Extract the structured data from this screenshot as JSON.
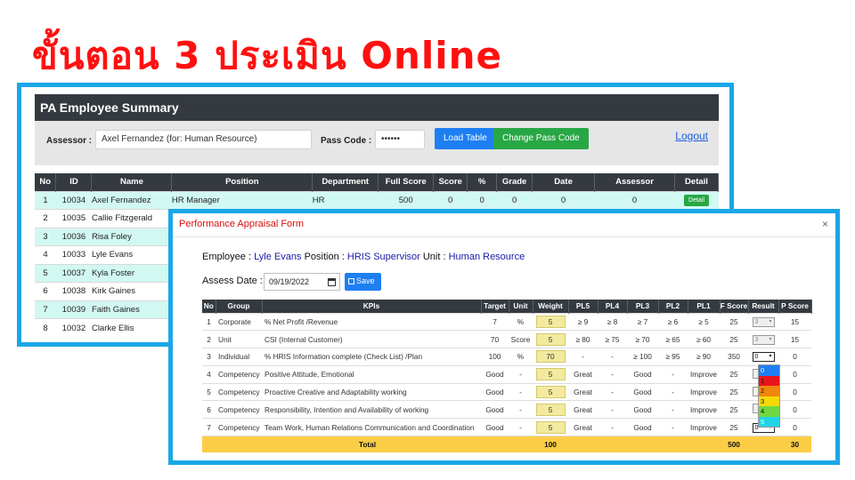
{
  "headline": "ขั้นตอน 3 ประเมิน Online",
  "back": {
    "title": "PA Employee Summary",
    "assessor_label": "Assessor :",
    "assessor_value": "Axel Fernandez (for: Human Resource)",
    "pass_label": "Pass Code :",
    "pass_value": "••••••",
    "load_label": "Load Table",
    "change_label": "Change Pass Code",
    "logout_label": "Logout",
    "columns": [
      "No",
      "ID",
      "Name",
      "Position",
      "Department",
      "Full Score",
      "Score",
      "%",
      "Grade",
      "Date",
      "Assessor",
      "Detail"
    ],
    "rows": [
      {
        "no": "1",
        "id": "10034",
        "name": "Axel Fernandez",
        "position": "HR Manager",
        "dept": "HR",
        "full": "500",
        "score": "0",
        "pct": "0",
        "grade": "0",
        "date": "0",
        "assessor": "0",
        "detail": "Detail"
      },
      {
        "no": "2",
        "id": "10035",
        "name": "Callie Fitzgerald",
        "position": "",
        "dept": "",
        "full": "",
        "score": "",
        "pct": "",
        "grade": "",
        "date": "",
        "assessor": "",
        "detail": ""
      },
      {
        "no": "3",
        "id": "10036",
        "name": "Risa Foley",
        "position": "",
        "dept": "",
        "full": "",
        "score": "",
        "pct": "",
        "grade": "",
        "date": "",
        "assessor": "",
        "detail": ""
      },
      {
        "no": "4",
        "id": "10033",
        "name": "Lyle Evans",
        "position": "",
        "dept": "",
        "full": "",
        "score": "",
        "pct": "",
        "grade": "",
        "date": "",
        "assessor": "",
        "detail": ""
      },
      {
        "no": "5",
        "id": "10037",
        "name": "Kyla Foster",
        "position": "",
        "dept": "",
        "full": "",
        "score": "",
        "pct": "",
        "grade": "",
        "date": "",
        "assessor": "",
        "detail": ""
      },
      {
        "no": "6",
        "id": "10038",
        "name": "Kirk Gaines",
        "position": "",
        "dept": "",
        "full": "",
        "score": "",
        "pct": "",
        "grade": "",
        "date": "",
        "assessor": "",
        "detail": ""
      },
      {
        "no": "7",
        "id": "10039",
        "name": "Faith Gaines",
        "position": "",
        "dept": "",
        "full": "",
        "score": "",
        "pct": "",
        "grade": "",
        "date": "",
        "assessor": "",
        "detail": ""
      },
      {
        "no": "8",
        "id": "10032",
        "name": "Clarke Ellis",
        "position": "",
        "dept": "",
        "full": "",
        "score": "",
        "pct": "",
        "grade": "",
        "date": "",
        "assessor": "",
        "detail": ""
      }
    ]
  },
  "modal": {
    "title": "Performance Appraisal Form",
    "close": "×",
    "employee_label": "Employee :",
    "employee_value": "Lyle Evans",
    "position_label": "Position :",
    "position_value": "HRIS Supervisor",
    "unit_label": "Unit :",
    "unit_value": "Human Resource",
    "assess_label": "Assess Date :",
    "assess_value": "09/19/2022",
    "save_label": "Save",
    "columns": [
      "No",
      "Group",
      "KPIs",
      "Target",
      "Unit",
      "Weight",
      "PL5",
      "PL4",
      "PL3",
      "PL2",
      "PL1",
      "F Score",
      "Result",
      "P Score"
    ],
    "rows": [
      {
        "no": "1",
        "group": "Corporate",
        "kpi": "% Net Profit /Revenue",
        "target": "7",
        "unit": "%",
        "weight": "5",
        "pl5": "≥ 9",
        "pl4": "≥ 8",
        "pl3": "≥ 7",
        "pl2": "≥ 6",
        "pl1": "≥ 5",
        "fscore": "25",
        "result": "3",
        "pscore": "15"
      },
      {
        "no": "2",
        "group": "Unit",
        "kpi": "CSI (Internal Customer)",
        "target": "70",
        "unit": "Score",
        "weight": "5",
        "pl5": "≥ 80",
        "pl4": "≥ 75",
        "pl3": "≥ 70",
        "pl2": "≥ 65",
        "pl1": "≥ 60",
        "fscore": "25",
        "result": "3",
        "pscore": "15"
      },
      {
        "no": "3",
        "group": "Individual",
        "kpi": "% HRIS Information complete (Check List) /Plan",
        "target": "100",
        "unit": "%",
        "weight": "70",
        "pl5": "-",
        "pl4": "-",
        "pl3": "≥ 100",
        "pl2": "≥ 95",
        "pl1": "≥ 90",
        "fscore": "350",
        "result": "0",
        "pscore": "0"
      },
      {
        "no": "4",
        "group": "Competency",
        "kpi": "Positive Attitude, Emotional",
        "target": "Good",
        "unit": "-",
        "weight": "5",
        "pl5": "Great",
        "pl4": "-",
        "pl3": "Good",
        "pl2": "-",
        "pl1": "Improve",
        "fscore": "25",
        "result": "",
        "pscore": "0"
      },
      {
        "no": "5",
        "group": "Competency",
        "kpi": "Proactive Creative and Adaptability working",
        "target": "Good",
        "unit": "-",
        "weight": "5",
        "pl5": "Great",
        "pl4": "-",
        "pl3": "Good",
        "pl2": "-",
        "pl1": "Improve",
        "fscore": "25",
        "result": "",
        "pscore": "0"
      },
      {
        "no": "6",
        "group": "Competency",
        "kpi": "Responsibility, Intention and Availability of working",
        "target": "Good",
        "unit": "-",
        "weight": "5",
        "pl5": "Great",
        "pl4": "-",
        "pl3": "Good",
        "pl2": "-",
        "pl1": "Improve",
        "fscore": "25",
        "result": "",
        "pscore": "0"
      },
      {
        "no": "7",
        "group": "Competency",
        "kpi": "Team Work, Human Relations Communication and Coordination",
        "target": "Good",
        "unit": "-",
        "weight": "5",
        "pl5": "Great",
        "pl4": "-",
        "pl3": "Good",
        "pl2": "-",
        "pl1": "Improve",
        "fscore": "25",
        "result": "0",
        "pscore": "0"
      }
    ],
    "total": {
      "label": "Total",
      "weight": "100",
      "fscore": "500",
      "pscore": "30"
    },
    "dropdown": {
      "options": [
        {
          "label": "0",
          "color": "#1e7ff2"
        },
        {
          "label": "1",
          "color": "#e8141c"
        },
        {
          "label": "2",
          "color": "#f0860e"
        },
        {
          "label": "3",
          "color": "#f5d90a"
        },
        {
          "label": "4",
          "color": "#6fd840"
        },
        {
          "label": "5",
          "color": "#22d3e6"
        }
      ]
    }
  }
}
